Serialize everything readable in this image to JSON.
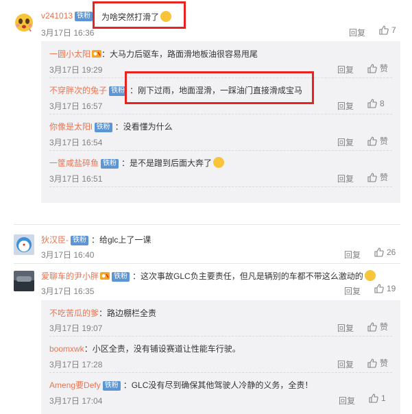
{
  "comments": [
    {
      "user": "v241013",
      "badge": "铁粉",
      "text": "为啥突然打滑了",
      "time": "3月17日 16:36",
      "reply": "回复",
      "likes": "7"
    },
    {
      "user": "狄汉臣-",
      "badge": "铁粉",
      "text": "：给glc上了一课",
      "time": "3月17日 16:40",
      "reply": "回复",
      "likes": "26"
    },
    {
      "user": "爱聊车的尹小胖",
      "badge": "铁粉",
      "text": "：这次事故GLC负主要责任，但凡是辆别的车都不带这么激动的",
      "time": "3月17日 16:35",
      "reply": "回复",
      "likes": "19"
    }
  ],
  "replies_a": [
    {
      "user": "一圆小太阳",
      "badge": "",
      "text": "：大马力后驱车，路面滑地板油很容易甩尾",
      "time": "3月17日 19:29",
      "reply": "回复",
      "likes": "赞"
    },
    {
      "user": "不穿胖次的兔子",
      "badge": "铁粉",
      "text": "：刚下过雨，地面湿滑，一踩油门直接滑成宝马",
      "time": "3月17日 16:57",
      "reply": "回复",
      "likes": "8"
    },
    {
      "user": "你像是太阳l",
      "badge": "铁粉",
      "text": "：没看懂为什么",
      "time": "3月17日 16:54",
      "reply": "回复",
      "likes": "赞"
    },
    {
      "user": "一筐咸盐碎鱼",
      "badge": "铁粉",
      "text": "：是不是蹭到后面大奔了",
      "time": "3月17日 16:51",
      "reply": "回复",
      "likes": "赞"
    }
  ],
  "replies_b": [
    {
      "user": "不吃苦瓜的爹",
      "badge": "",
      "text": "：路边棚栏全责",
      "time": "3月17日 19:07",
      "reply": "回复",
      "likes": "赞"
    },
    {
      "user": "boomxwk",
      "badge": "",
      "text": "：小区全责，没有铺设赛道让性能车行驶。",
      "time": "3月17日 17:28",
      "reply": "回复",
      "likes": "赞"
    },
    {
      "user": "Ameng要Defy",
      "badge": "铁粉",
      "text": "：GLC没有尽到确保其他驾驶人冷静的义务，全责！",
      "time": "3月17日 17:04",
      "reply": "回复",
      "likes": "1"
    }
  ]
}
